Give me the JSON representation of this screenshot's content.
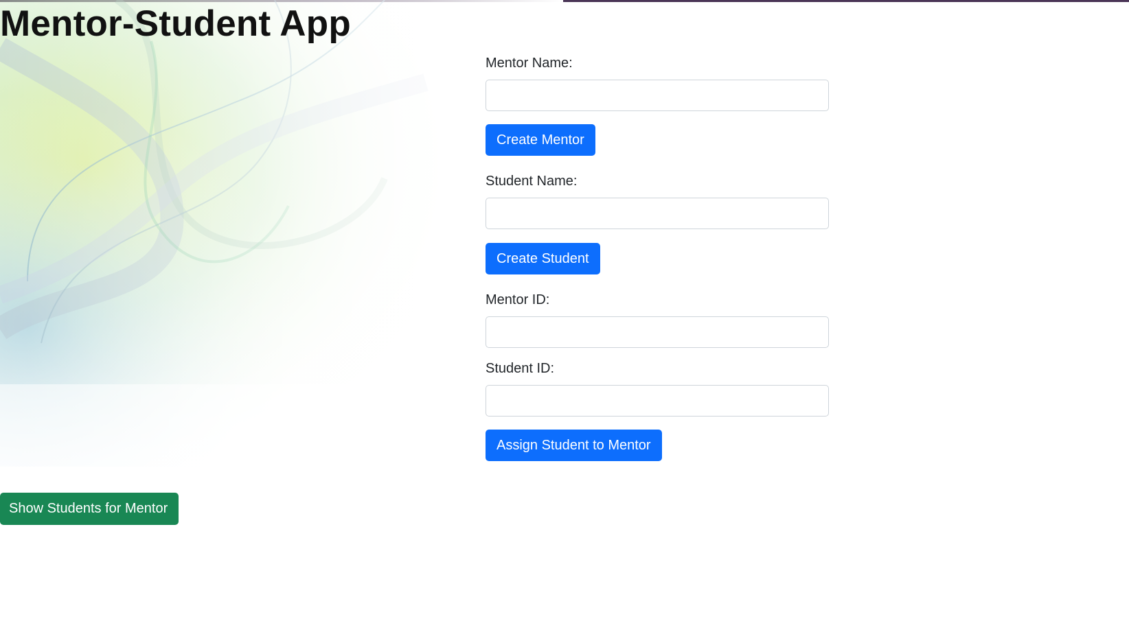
{
  "app": {
    "title": "Mentor-Student App"
  },
  "mentor_form": {
    "label": "Mentor Name:",
    "value": "",
    "placeholder": "",
    "button_label": "Create Mentor"
  },
  "student_form": {
    "label": "Student Name:",
    "value": "",
    "placeholder": "",
    "button_label": "Create Student"
  },
  "assign_form": {
    "mentor_id_label": "Mentor ID:",
    "mentor_id_value": "",
    "student_id_label": "Student ID:",
    "student_id_value": "",
    "button_label": "Assign Student to Mentor"
  },
  "show_students": {
    "button_label": "Show Students for Mentor"
  },
  "colors": {
    "primary_button": "#0d6efd",
    "success_button": "#198754",
    "top_border": "#4a3556"
  }
}
